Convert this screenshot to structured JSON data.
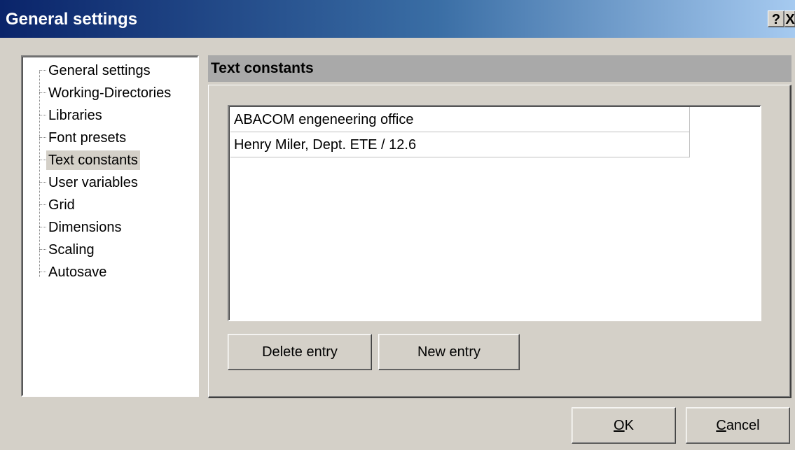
{
  "window": {
    "title": "General settings",
    "help_label": "?",
    "close_label": "X"
  },
  "tree": {
    "items": [
      {
        "label": "General settings",
        "selected": false
      },
      {
        "label": "Working-Directories",
        "selected": false
      },
      {
        "label": "Libraries",
        "selected": false
      },
      {
        "label": "Font presets",
        "selected": false
      },
      {
        "label": "Text constants",
        "selected": true
      },
      {
        "label": "User variables",
        "selected": false
      },
      {
        "label": "Grid",
        "selected": false
      },
      {
        "label": "Dimensions",
        "selected": false
      },
      {
        "label": "Scaling",
        "selected": false
      },
      {
        "label": "Autosave",
        "selected": false
      }
    ]
  },
  "section": {
    "title": "Text constants"
  },
  "constants": {
    "entries": [
      "ABACOM engeneering office",
      "Henry Miler, Dept. ETE / 12.6"
    ]
  },
  "buttons": {
    "delete_label": "Delete entry",
    "new_label": "New entry",
    "ok_label": "OK",
    "cancel_label": "Cancel"
  },
  "colors": {
    "titlebar_start": "#0a246a",
    "titlebar_end": "#a6caf0",
    "face": "#d4d0c8",
    "header_gray": "#a9a9a9"
  }
}
